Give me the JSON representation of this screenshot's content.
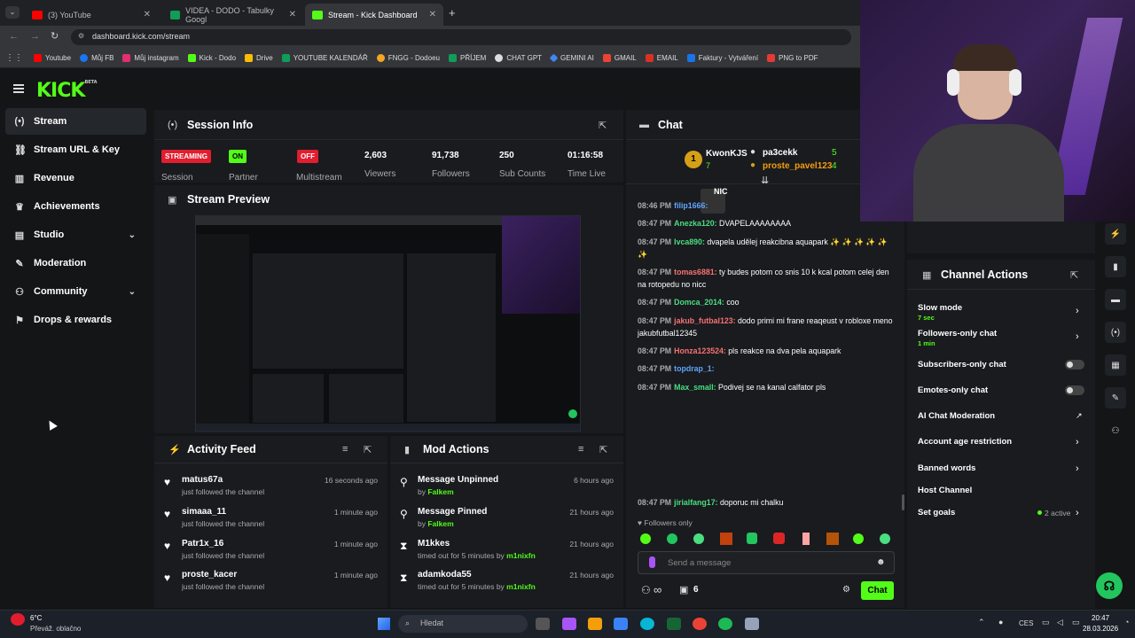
{
  "browser": {
    "tabs": [
      {
        "label": "(3) YouTube",
        "color": "#ff0000"
      },
      {
        "label": "VIDEA - DODO - Tabulky Googl",
        "color": "#0f9d58"
      },
      {
        "label": "Stream - Kick Dashboard",
        "color": "#53fc18"
      }
    ],
    "url": "dashboard.kick.com/stream",
    "bookmarks": [
      {
        "label": "Youtube",
        "color": "#ff0000"
      },
      {
        "label": "Můj FB",
        "color": "#1877f2"
      },
      {
        "label": "Můj instagram",
        "color": "#e1306c"
      },
      {
        "label": "Kick - Dodo",
        "color": "#53fc18"
      },
      {
        "label": "Drive",
        "color": "#fbbc04"
      },
      {
        "label": "YOUTUBE KALENDÁŘ",
        "color": "#0f9d58"
      },
      {
        "label": "FNGG - Dodoeu",
        "color": "#f5a623"
      },
      {
        "label": "PŘÍJEM",
        "color": "#0f9d58"
      },
      {
        "label": "CHAT GPT",
        "color": "#dddddd"
      },
      {
        "label": "GEMINI AI",
        "color": "#4285f4"
      },
      {
        "label": "GMAIL",
        "color": "#ea4335"
      },
      {
        "label": "EMAIL",
        "color": "#d93025"
      },
      {
        "label": "Faktury - Vytváření",
        "color": "#1a73e8"
      },
      {
        "label": "PNG to PDF",
        "color": "#e53935"
      }
    ]
  },
  "sidebar": {
    "items": [
      {
        "label": "Stream",
        "icon": "(•)"
      },
      {
        "label": "Stream URL & Key",
        "icon": "🔗"
      },
      {
        "label": "Revenue",
        "icon": "▥"
      },
      {
        "label": "Achievements",
        "icon": "🏆"
      },
      {
        "label": "Studio",
        "icon": "▤"
      },
      {
        "label": "Moderation",
        "icon": "🔧"
      },
      {
        "label": "Community",
        "icon": "👥"
      },
      {
        "label": "Drops & rewards",
        "icon": "🎁"
      }
    ]
  },
  "session": {
    "title": "Session Info",
    "streaming": "STREAMING",
    "partner_on": "ON",
    "multistream_off": "OFF",
    "labels": {
      "session": "Session",
      "partner": "Partner",
      "multistream": "Multistream"
    },
    "stats": [
      {
        "value": "2,603",
        "label": "Viewers"
      },
      {
        "value": "91,738",
        "label": "Followers"
      },
      {
        "value": "250",
        "label": "Sub Counts"
      },
      {
        "value": "01:16:58",
        "label": "Time Live"
      }
    ]
  },
  "preview": {
    "title": "Stream Preview"
  },
  "activity": {
    "title": "Activity Feed",
    "rows": [
      {
        "name": "matus67a",
        "sub": "just followed the channel",
        "time": "16 seconds ago"
      },
      {
        "name": "simaaa_11",
        "sub": "just followed the channel",
        "time": "1 minute ago"
      },
      {
        "name": "Patr1x_16",
        "sub": "just followed the channel",
        "time": "1 minute ago"
      },
      {
        "name": "proste_kacer",
        "sub": "just followed the channel",
        "time": "1 minute ago"
      }
    ]
  },
  "mod": {
    "title": "Mod Actions",
    "rows": [
      {
        "name": "Message Unpinned",
        "pre": "by",
        "by": "Falkem",
        "time": "6 hours ago",
        "icon": "⚲"
      },
      {
        "name": "Message Pinned",
        "pre": "by",
        "by": "Falkem",
        "time": "21 hours ago",
        "icon": "⚲"
      },
      {
        "name": "M1kkes",
        "pre": "timed out for 5 minutes by",
        "by": "m1nixfn",
        "time": "21 hours ago",
        "icon": "⧗"
      },
      {
        "name": "adamkoda55",
        "pre": "timed out for 5 minutes by",
        "by": "m1nixfn",
        "time": "21 hours ago",
        "icon": "⧗"
      }
    ]
  },
  "chat": {
    "title": "Chat",
    "top_gifter": {
      "rank": "1",
      "name": "KwonKJS",
      "count": "7"
    },
    "gifters": [
      {
        "name": "pa3cekk",
        "count": "5"
      },
      {
        "name": "proste_pavel123",
        "count": "4"
      }
    ],
    "messages": [
      {
        "time": "08:46 PM",
        "user": "filip1666:",
        "color": "#60a5fa",
        "text": ""
      },
      {
        "time": "08:47 PM",
        "user": "Anezka120:",
        "color": "#4ade80",
        "text": "DVAPELAAAAAAAA"
      },
      {
        "time": "08:47 PM",
        "user": "Ivca890:",
        "color": "#4ade80",
        "text": "dvapela udělej reakcibna aquapark ✨ ✨ ✨ ✨ ✨ ✨"
      },
      {
        "time": "08:47 PM",
        "user": "tomas6881:",
        "color": "#f87171",
        "text": "ty budes potom co snis 10 k kcal potom celej den na rotopedu no nicc"
      },
      {
        "time": "08:47 PM",
        "user": "Domca_2014:",
        "color": "#4ade80",
        "text": "coo"
      },
      {
        "time": "08:47 PM",
        "user": "jakub_futbal123:",
        "color": "#f87171",
        "text": "dodo primi mi frane reaqeust v robloxe meno jakubfutbal12345"
      },
      {
        "time": "08:47 PM",
        "user": "Honza123524:",
        "color": "#f87171",
        "text": "pls reakce na dva pela aquapark"
      },
      {
        "time": "08:47 PM",
        "user": "topdrap_1:",
        "color": "#60a5fa",
        "text": ""
      },
      {
        "time": "08:47 PM",
        "user": "Max_small:",
        "color": "#4ade80",
        "text": "Podivej se na kanal calfator pls"
      },
      {
        "time": "08:47 PM",
        "user": "jirialfang17:",
        "color": "#4ade80",
        "text": "doporuc mi chalku"
      }
    ],
    "followers_only": "Followers only",
    "placeholder": "Send a message",
    "infinity": "∞",
    "gift_count": "6",
    "send": "Chat",
    "clip_label": "NIC"
  },
  "actions": {
    "title": "Channel Actions",
    "items": [
      {
        "label": "Slow mode",
        "sub": "7 sec"
      },
      {
        "label": "Followers-only chat",
        "sub": "1 min"
      },
      {
        "label": "Subscribers-only chat"
      },
      {
        "label": "Emotes-only chat"
      },
      {
        "label": "AI Chat Moderation"
      },
      {
        "label": "Account age restriction"
      },
      {
        "label": "Banned words"
      },
      {
        "label": "Host Channel"
      },
      {
        "label": "Set goals",
        "sub": "2 active"
      }
    ]
  },
  "taskbar": {
    "weather_temp": "6°C",
    "weather_desc": "Převáž. oblačno",
    "search": "Hledat",
    "lang": "CES",
    "time": "20:47",
    "date": "28.03.2026"
  },
  "colors": {
    "accent": "#53fc18",
    "panel": "#191b1f",
    "bg": "#141517"
  }
}
